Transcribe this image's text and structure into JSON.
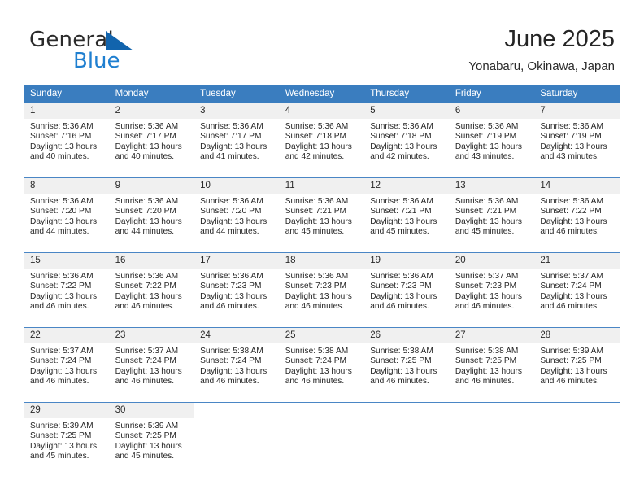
{
  "brand": {
    "name_part1": "General",
    "name_part2": "Blue",
    "triangle_icon": "blue-triangle-icon",
    "color_dark": "#2b2b2b",
    "color_blue": "#1f7fd0"
  },
  "header": {
    "title": "June 2025",
    "subtitle": "Yonabaru, Okinawa, Japan"
  },
  "theme": {
    "header_bg": "#3a7dbf",
    "daynum_bg": "#f0f0f0",
    "row_divider": "#4a86c5",
    "text": "#262626"
  },
  "weekdays": [
    "Sunday",
    "Monday",
    "Tuesday",
    "Wednesday",
    "Thursday",
    "Friday",
    "Saturday"
  ],
  "weeks": [
    [
      {
        "day": "1",
        "sunrise": "Sunrise: 5:36 AM",
        "sunset": "Sunset: 7:16 PM",
        "daylight": "Daylight: 13 hours and 40 minutes."
      },
      {
        "day": "2",
        "sunrise": "Sunrise: 5:36 AM",
        "sunset": "Sunset: 7:17 PM",
        "daylight": "Daylight: 13 hours and 40 minutes."
      },
      {
        "day": "3",
        "sunrise": "Sunrise: 5:36 AM",
        "sunset": "Sunset: 7:17 PM",
        "daylight": "Daylight: 13 hours and 41 minutes."
      },
      {
        "day": "4",
        "sunrise": "Sunrise: 5:36 AM",
        "sunset": "Sunset: 7:18 PM",
        "daylight": "Daylight: 13 hours and 42 minutes."
      },
      {
        "day": "5",
        "sunrise": "Sunrise: 5:36 AM",
        "sunset": "Sunset: 7:18 PM",
        "daylight": "Daylight: 13 hours and 42 minutes."
      },
      {
        "day": "6",
        "sunrise": "Sunrise: 5:36 AM",
        "sunset": "Sunset: 7:19 PM",
        "daylight": "Daylight: 13 hours and 43 minutes."
      },
      {
        "day": "7",
        "sunrise": "Sunrise: 5:36 AM",
        "sunset": "Sunset: 7:19 PM",
        "daylight": "Daylight: 13 hours and 43 minutes."
      }
    ],
    [
      {
        "day": "8",
        "sunrise": "Sunrise: 5:36 AM",
        "sunset": "Sunset: 7:20 PM",
        "daylight": "Daylight: 13 hours and 44 minutes."
      },
      {
        "day": "9",
        "sunrise": "Sunrise: 5:36 AM",
        "sunset": "Sunset: 7:20 PM",
        "daylight": "Daylight: 13 hours and 44 minutes."
      },
      {
        "day": "10",
        "sunrise": "Sunrise: 5:36 AM",
        "sunset": "Sunset: 7:20 PM",
        "daylight": "Daylight: 13 hours and 44 minutes."
      },
      {
        "day": "11",
        "sunrise": "Sunrise: 5:36 AM",
        "sunset": "Sunset: 7:21 PM",
        "daylight": "Daylight: 13 hours and 45 minutes."
      },
      {
        "day": "12",
        "sunrise": "Sunrise: 5:36 AM",
        "sunset": "Sunset: 7:21 PM",
        "daylight": "Daylight: 13 hours and 45 minutes."
      },
      {
        "day": "13",
        "sunrise": "Sunrise: 5:36 AM",
        "sunset": "Sunset: 7:21 PM",
        "daylight": "Daylight: 13 hours and 45 minutes."
      },
      {
        "day": "14",
        "sunrise": "Sunrise: 5:36 AM",
        "sunset": "Sunset: 7:22 PM",
        "daylight": "Daylight: 13 hours and 46 minutes."
      }
    ],
    [
      {
        "day": "15",
        "sunrise": "Sunrise: 5:36 AM",
        "sunset": "Sunset: 7:22 PM",
        "daylight": "Daylight: 13 hours and 46 minutes."
      },
      {
        "day": "16",
        "sunrise": "Sunrise: 5:36 AM",
        "sunset": "Sunset: 7:22 PM",
        "daylight": "Daylight: 13 hours and 46 minutes."
      },
      {
        "day": "17",
        "sunrise": "Sunrise: 5:36 AM",
        "sunset": "Sunset: 7:23 PM",
        "daylight": "Daylight: 13 hours and 46 minutes."
      },
      {
        "day": "18",
        "sunrise": "Sunrise: 5:36 AM",
        "sunset": "Sunset: 7:23 PM",
        "daylight": "Daylight: 13 hours and 46 minutes."
      },
      {
        "day": "19",
        "sunrise": "Sunrise: 5:36 AM",
        "sunset": "Sunset: 7:23 PM",
        "daylight": "Daylight: 13 hours and 46 minutes."
      },
      {
        "day": "20",
        "sunrise": "Sunrise: 5:37 AM",
        "sunset": "Sunset: 7:23 PM",
        "daylight": "Daylight: 13 hours and 46 minutes."
      },
      {
        "day": "21",
        "sunrise": "Sunrise: 5:37 AM",
        "sunset": "Sunset: 7:24 PM",
        "daylight": "Daylight: 13 hours and 46 minutes."
      }
    ],
    [
      {
        "day": "22",
        "sunrise": "Sunrise: 5:37 AM",
        "sunset": "Sunset: 7:24 PM",
        "daylight": "Daylight: 13 hours and 46 minutes."
      },
      {
        "day": "23",
        "sunrise": "Sunrise: 5:37 AM",
        "sunset": "Sunset: 7:24 PM",
        "daylight": "Daylight: 13 hours and 46 minutes."
      },
      {
        "day": "24",
        "sunrise": "Sunrise: 5:38 AM",
        "sunset": "Sunset: 7:24 PM",
        "daylight": "Daylight: 13 hours and 46 minutes."
      },
      {
        "day": "25",
        "sunrise": "Sunrise: 5:38 AM",
        "sunset": "Sunset: 7:24 PM",
        "daylight": "Daylight: 13 hours and 46 minutes."
      },
      {
        "day": "26",
        "sunrise": "Sunrise: 5:38 AM",
        "sunset": "Sunset: 7:25 PM",
        "daylight": "Daylight: 13 hours and 46 minutes."
      },
      {
        "day": "27",
        "sunrise": "Sunrise: 5:38 AM",
        "sunset": "Sunset: 7:25 PM",
        "daylight": "Daylight: 13 hours and 46 minutes."
      },
      {
        "day": "28",
        "sunrise": "Sunrise: 5:39 AM",
        "sunset": "Sunset: 7:25 PM",
        "daylight": "Daylight: 13 hours and 46 minutes."
      }
    ],
    [
      {
        "day": "29",
        "sunrise": "Sunrise: 5:39 AM",
        "sunset": "Sunset: 7:25 PM",
        "daylight": "Daylight: 13 hours and 45 minutes."
      },
      {
        "day": "30",
        "sunrise": "Sunrise: 5:39 AM",
        "sunset": "Sunset: 7:25 PM",
        "daylight": "Daylight: 13 hours and 45 minutes."
      },
      {
        "day": "",
        "sunrise": "",
        "sunset": "",
        "daylight": ""
      },
      {
        "day": "",
        "sunrise": "",
        "sunset": "",
        "daylight": ""
      },
      {
        "day": "",
        "sunrise": "",
        "sunset": "",
        "daylight": ""
      },
      {
        "day": "",
        "sunrise": "",
        "sunset": "",
        "daylight": ""
      },
      {
        "day": "",
        "sunrise": "",
        "sunset": "",
        "daylight": ""
      }
    ]
  ]
}
